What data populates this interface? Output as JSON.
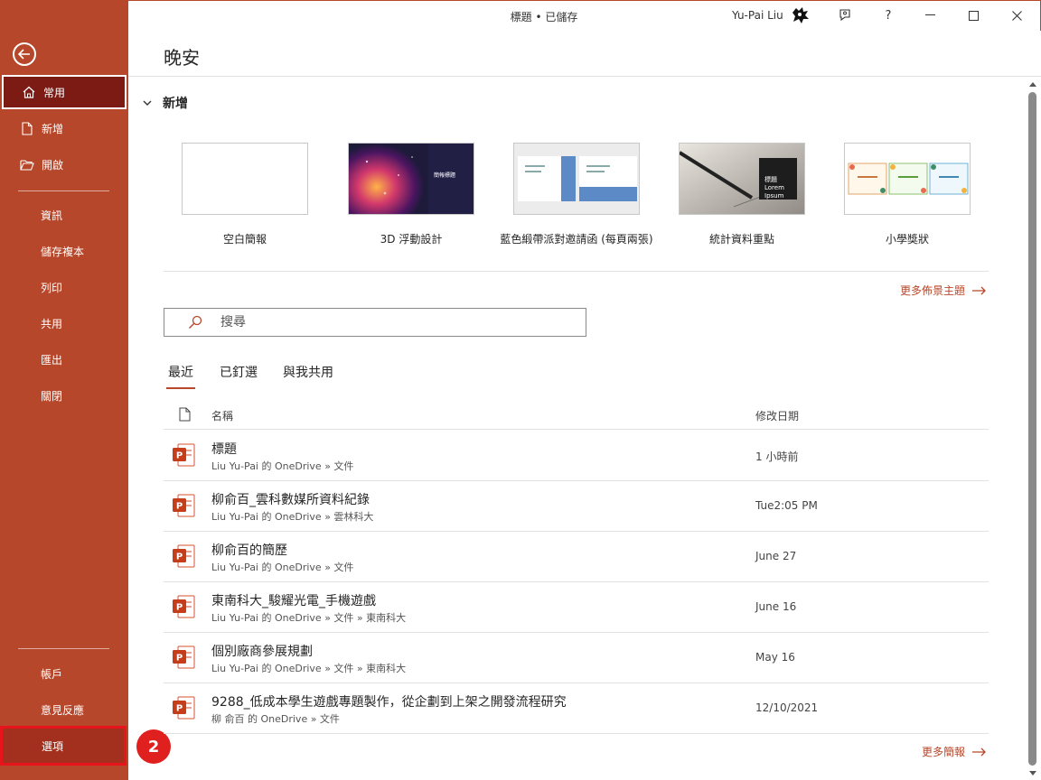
{
  "window": {
    "title": "標題 • 已儲存",
    "user": "Yu-Pai Liu"
  },
  "sidebar": {
    "items": [
      {
        "label": "常用"
      },
      {
        "label": "新增"
      },
      {
        "label": "開啟"
      },
      {
        "label": "資訊"
      },
      {
        "label": "儲存複本"
      },
      {
        "label": "列印"
      },
      {
        "label": "共用"
      },
      {
        "label": "匯出"
      },
      {
        "label": "關閉"
      },
      {
        "label": "帳戶"
      },
      {
        "label": "意見反應"
      },
      {
        "label": "選項"
      }
    ]
  },
  "step_badge": "2",
  "main": {
    "greeting": "晚安",
    "new_section": "新增",
    "templates": [
      {
        "label": "空白簡報"
      },
      {
        "label": "3D 浮動設計",
        "thumb_text": "簡報標題"
      },
      {
        "label": "藍色緞帶派對邀請函 (每頁兩張)"
      },
      {
        "label": "統計資料重點",
        "thumb_text": "標題 Lorem Ipsum"
      },
      {
        "label": "小學獎狀"
      }
    ],
    "more_themes": "更多佈景主題",
    "search_placeholder": "搜尋",
    "tabs": [
      "最近",
      "已釘選",
      "與我共用"
    ],
    "list_headers": {
      "name": "名稱",
      "date": "修改日期"
    },
    "files": [
      {
        "name": "標題",
        "path": "Liu Yu-Pai 的 OneDrive » 文件",
        "date": "1 小時前"
      },
      {
        "name": "柳俞百_雲科數媒所資料紀錄",
        "path": "Liu Yu-Pai 的 OneDrive » 雲林科大",
        "date": "Tue2:05 PM"
      },
      {
        "name": "柳俞百的簡歷",
        "path": "Liu Yu-Pai 的 OneDrive » 文件",
        "date": "June 27"
      },
      {
        "name": "東南科大_駿耀光電_手機遊戲",
        "path": "Liu Yu-Pai 的 OneDrive » 文件 » 東南科大",
        "date": "June 16"
      },
      {
        "name": "個別廠商參展規劃",
        "path": "Liu Yu-Pai 的 OneDrive » 文件 » 東南科大",
        "date": "May 16"
      },
      {
        "name": "9288_低成本學生遊戲專題製作，從企劃到上架之開發流程研究",
        "path": "柳 俞百 的 OneDrive » 文件",
        "date": "12/10/2021"
      }
    ],
    "more_presentations": "更多簡報"
  },
  "colors": {
    "accent": "#b7472a",
    "active_nav": "#7c1b14",
    "highlight": "#e8141b"
  }
}
